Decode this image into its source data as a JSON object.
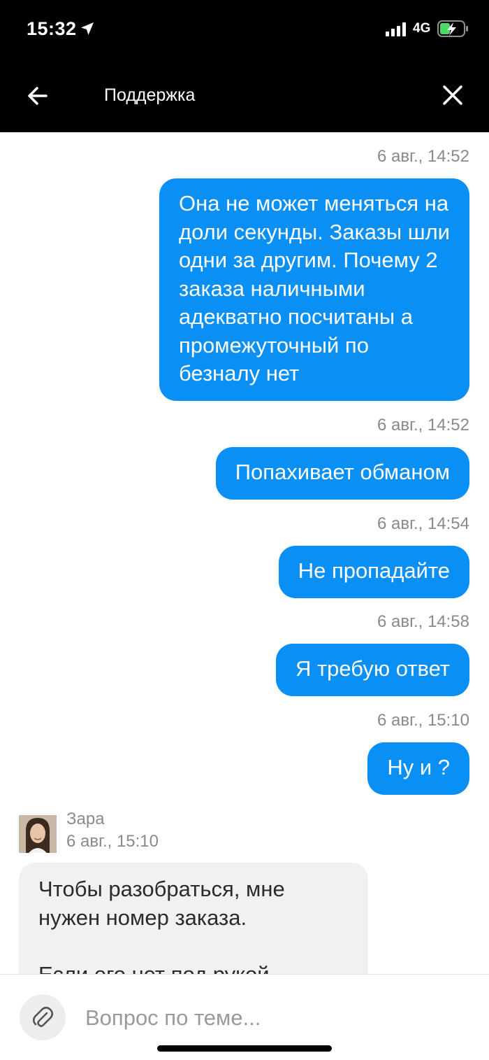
{
  "status_bar": {
    "time": "15:32",
    "network": "4G"
  },
  "header": {
    "title": "Поддержка"
  },
  "messages": [
    {
      "time": "6 авг., 14:52",
      "text": "Она не может меняться на\nдоли секунды. Заказы шли\nодни за другим. Почему 2\nзаказа наличными\nадекватно посчитаны а\nпромежуточный по\nбезналу нет"
    },
    {
      "time": "6 авг., 14:52",
      "text": "Попахивает обманом"
    },
    {
      "time": "6 авг., 14:54",
      "text": "Не пропадайте"
    },
    {
      "time": "6 авг., 14:58",
      "text": "Я требую ответ"
    },
    {
      "time": "6 авг., 15:10",
      "text": "Ну и ?"
    }
  ],
  "agent": {
    "name": "Зара",
    "time": "6 авг., 15:10",
    "text_line1": "Чтобы разобраться, мне",
    "text_line2": "нужен номер заказа.",
    "text_line3": "Если его нет под рукой"
  },
  "input": {
    "placeholder": "Вопрос по теме..."
  },
  "colors": {
    "accent": "#0a8ff5",
    "incoming_bubble": "#f1f1f1",
    "header_bg": "#000000"
  }
}
